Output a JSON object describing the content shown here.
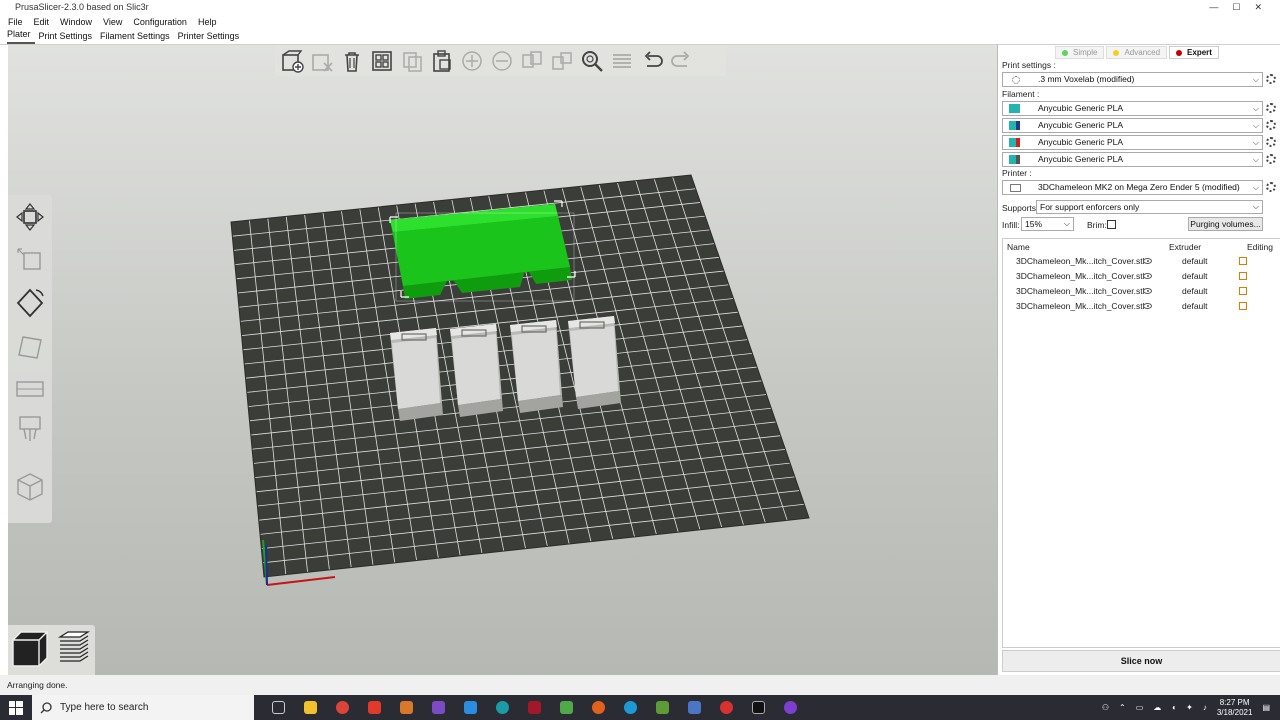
{
  "window": {
    "title": "PrusaSlicer-2.3.0 based on Slic3r",
    "controls": [
      "—",
      "☐",
      "✕"
    ]
  },
  "menu": [
    "File",
    "Edit",
    "Window",
    "View",
    "Configuration",
    "Help"
  ],
  "tabs": [
    {
      "label": "Plater",
      "active": true
    },
    {
      "label": "Print Settings",
      "active": false
    },
    {
      "label": "Filament Settings",
      "active": false
    },
    {
      "label": "Printer Settings",
      "active": false
    }
  ],
  "toolbar_icons": [
    "add-icon",
    "delete-icon",
    "delete-all-icon",
    "arrange-icon",
    "copy-icon",
    "paste-icon",
    "add-instance-icon",
    "remove-instance-icon",
    "split-objects-icon",
    "split-parts-icon",
    "search-icon",
    "layers-editing-icon",
    "undo-icon",
    "redo-icon"
  ],
  "modes": [
    {
      "label": "Simple",
      "color": "#5fd35f",
      "active": false
    },
    {
      "label": "Advanced",
      "color": "#f5d020",
      "active": false
    },
    {
      "label": "Expert",
      "color": "#c00000",
      "active": true
    }
  ],
  "sidebar": {
    "print_settings_label": "Print settings :",
    "print_settings_value": ".3 mm Voxelab (modified)",
    "filament_label": "Filament :",
    "filaments": [
      {
        "name": "Anycubic Generic PLA",
        "colors": [
          "#25b3b0",
          "#25b3b0"
        ]
      },
      {
        "name": "Anycubic Generic PLA",
        "colors": [
          "#25b3b0",
          "#1d3a8c"
        ]
      },
      {
        "name": "Anycubic Generic PLA",
        "colors": [
          "#25b3b0",
          "#d41f1f"
        ]
      },
      {
        "name": "Anycubic Generic PLA",
        "colors": [
          "#25b3b0",
          "#555555"
        ]
      }
    ],
    "printer_label": "Printer :",
    "printer_value": "3DChameleon MK2 on Mega Zero Ender 5 (modified)",
    "supports_label": "Supports:",
    "supports_value": "For support enforcers only",
    "infill_label": "Infill:",
    "infill_value": "15%",
    "brim_label": "Brim:",
    "brim_checked": false,
    "purging_button": "Purging volumes...",
    "list_headers": {
      "name": "Name",
      "extruder": "Extruder",
      "editing": "Editing"
    },
    "objects": [
      {
        "name": "3DChameleon_Mk...itch_Cover.stl",
        "extruder": "default"
      },
      {
        "name": "3DChameleon_Mk...itch_Cover.stl",
        "extruder": "default"
      },
      {
        "name": "3DChameleon_Mk...itch_Cover.stl",
        "extruder": "default"
      },
      {
        "name": "3DChameleon_Mk...itch_Cover.stl",
        "extruder": "default"
      }
    ],
    "slice_button": "Slice now"
  },
  "status": "Arranging done.",
  "taskbar": {
    "search_placeholder": "Type here to search",
    "time": "8:27 PM",
    "date": "3/18/2021"
  },
  "colors": {
    "bed": "#3b3d39",
    "grid": "#ffffff",
    "selected_object": "#19cc19",
    "unselected_object": "#d3d4d1"
  }
}
